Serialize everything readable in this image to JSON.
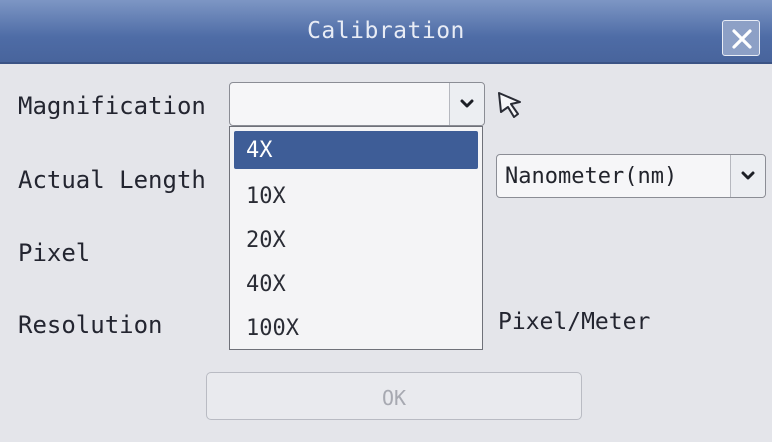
{
  "window": {
    "title": "Calibration",
    "close_icon": "close-icon"
  },
  "fields": {
    "magnification_label": "Magnification",
    "magnification_value": "",
    "actual_length_label": "Actual Length",
    "unit_value": "Nanometer(nm)",
    "pixel_label": "Pixel",
    "resolution_label": "Resolution",
    "resolution_unit": "Pixel/Meter"
  },
  "magnification_options": [
    "4X",
    "10X",
    "20X",
    "40X",
    "100X"
  ],
  "selected_option": "4X",
  "buttons": {
    "ok_label": "OK"
  },
  "icons": {
    "dropdown": "chevron-down-icon",
    "cursor": "mouse-pointer-icon"
  },
  "colors": {
    "titlebar": "#4e6ca6",
    "selection": "#3e5d97",
    "dialog_bg": "#e4e5ea"
  }
}
